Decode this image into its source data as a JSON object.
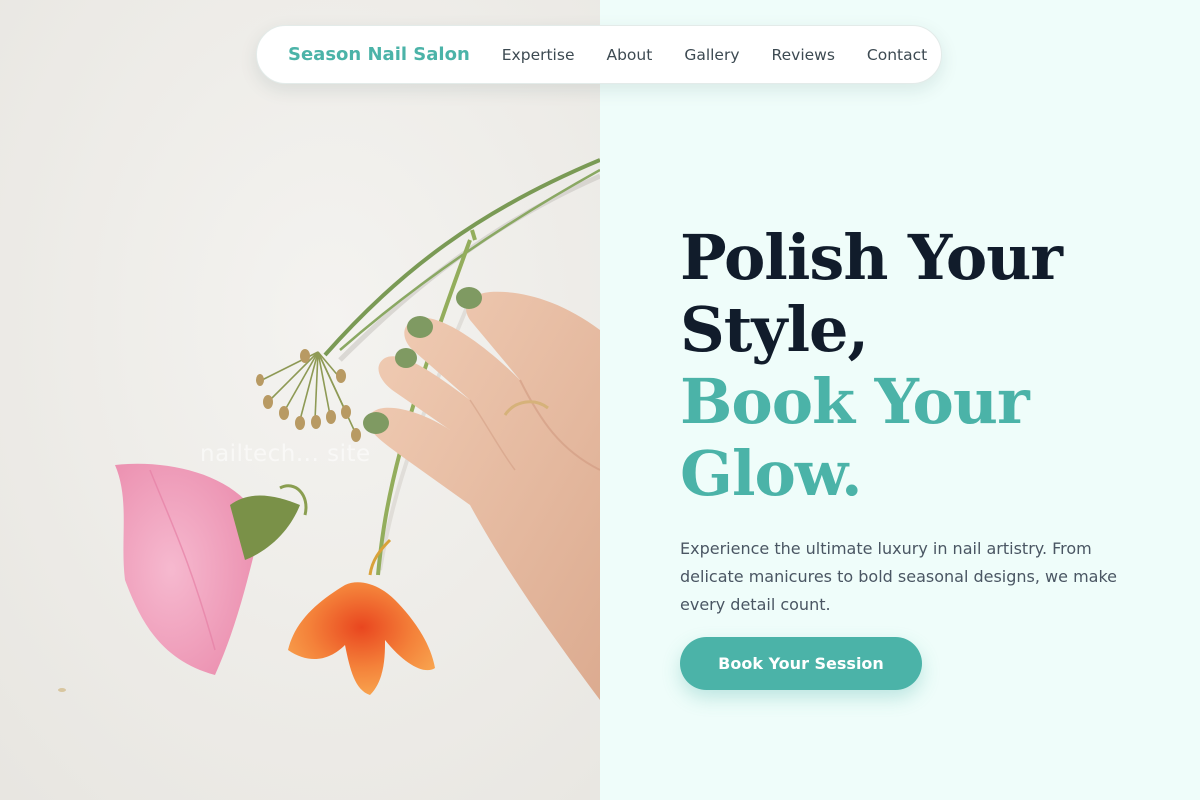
{
  "brand": {
    "name": "Season Nail Salon",
    "color": "#4bb3a8"
  },
  "nav": {
    "links": [
      {
        "label": "Expertise"
      },
      {
        "label": "About"
      },
      {
        "label": "Gallery"
      },
      {
        "label": "Reviews"
      },
      {
        "label": "Contact"
      }
    ]
  },
  "hero": {
    "headline_dark": [
      "Polish Your",
      "Style,"
    ],
    "headline_accent": [
      "Book Your",
      "Glow."
    ],
    "description": "Experience the ultimate luxury in nail artistry. From delicate manicures to bold seasonal designs, we make every detail count.",
    "cta_label": "Book Your Session",
    "image_watermark": "nailtech... site",
    "image_alt": "Hand with green manicure holding flowers"
  },
  "colors": {
    "accent": "#4bb3a8",
    "heading": "#111c2b",
    "text": "#4a5663",
    "panel_background": "#effdfa",
    "image_background": "#ecebe7"
  }
}
